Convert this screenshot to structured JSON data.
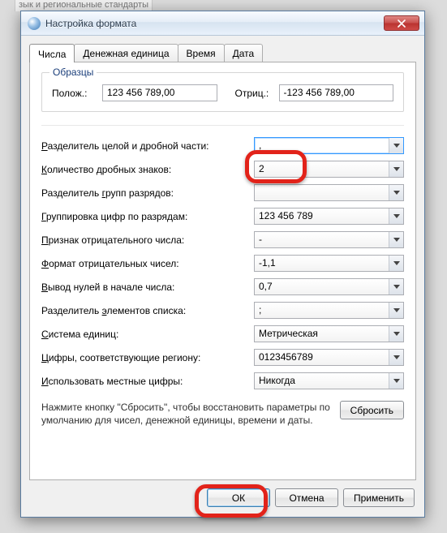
{
  "background_window_title": "зык и региональные стандарты",
  "window": {
    "title": "Настройка формата",
    "close_tooltip": "Закрыть"
  },
  "tabs": {
    "numbers": "Числа",
    "currency": "Денежная единица",
    "time": "Время",
    "date": "Дата"
  },
  "samples": {
    "legend": "Образцы",
    "positive_label": "Полож.:",
    "positive_value": "123 456 789,00",
    "negative_label": "Отриц.:",
    "negative_value": "-123 456 789,00"
  },
  "fields": {
    "decimal_sep": {
      "label_pre": "",
      "label_ul": "Р",
      "label_post": "азделитель целой и дробной части:",
      "value": ","
    },
    "decimal_digits": {
      "label_pre": "",
      "label_ul": "К",
      "label_post": "оличество дробных знаков:",
      "value": "2"
    },
    "group_sep": {
      "label_pre": "Разделитель ",
      "label_ul": "г",
      "label_post": "рупп разрядов:",
      "value": ""
    },
    "digit_group": {
      "label_pre": "",
      "label_ul": "Г",
      "label_post": "руппировка цифр по разрядам:",
      "value": "123 456 789"
    },
    "neg_sign": {
      "label_pre": "",
      "label_ul": "П",
      "label_post": "ризнак отрицательного числа:",
      "value": "-"
    },
    "neg_format": {
      "label_pre": "",
      "label_ul": "Ф",
      "label_post": "ормат отрицательных чисел:",
      "value": "-1,1"
    },
    "leading_zero": {
      "label_pre": "",
      "label_ul": "В",
      "label_post": "ывод нулей в начале числа:",
      "value": "0,7"
    },
    "list_sep": {
      "label_pre": "Разделитель ",
      "label_ul": "э",
      "label_post": "лементов списка:",
      "value": ";"
    },
    "measure": {
      "label_pre": "",
      "label_ul": "С",
      "label_post": "истема единиц:",
      "value": "Метрическая"
    },
    "native_digits": {
      "label_pre": "",
      "label_ul": "Ц",
      "label_post": "ифры, соответствующие региону:",
      "value": "0123456789"
    },
    "use_native": {
      "label_pre": "",
      "label_ul": "И",
      "label_post": "спользовать местные цифры:",
      "value": "Никогда"
    }
  },
  "reset": {
    "text": "Нажмите кнопку \"Сбросить\", чтобы восстановить параметры по умолчанию для чисел, денежной единицы, времени и даты.",
    "button": "Сбросить"
  },
  "footer": {
    "ok": "ОК",
    "cancel": "Отмена",
    "apply": "Применить"
  }
}
